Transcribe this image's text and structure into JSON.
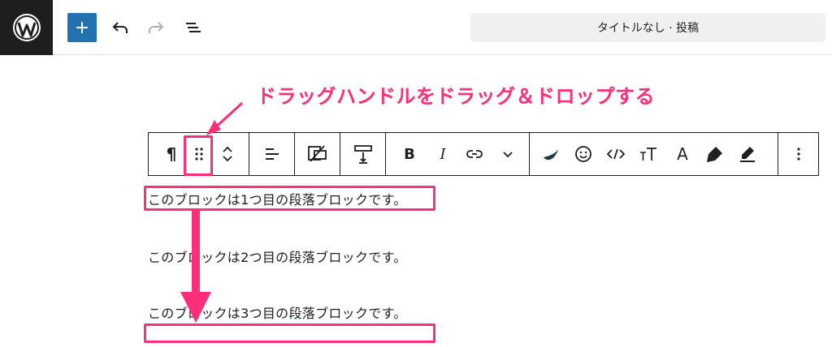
{
  "header": {
    "logo_icon": "wordpress-logo",
    "add_block_icon": "plus-icon",
    "undo_icon": "undo-icon",
    "redo_icon": "redo-icon",
    "list_view_icon": "list-view-icon",
    "document_title": "タイトルなし · 投稿"
  },
  "annotation": {
    "text": "ドラッグハンドルをドラッグ＆ドロップする",
    "color": "#ff2d7a"
  },
  "toolbar": {
    "paragraph_symbol": "¶",
    "tools": [
      "paragraph-icon",
      "drag-handle-icon",
      "move-up-icon",
      "move-down-icon",
      "align-left-icon",
      "image-swap-icon",
      "spacer-icon",
      "bold-icon",
      "italic-icon",
      "link-icon",
      "chevron-down-icon",
      "brand-leaf-icon",
      "emoji-icon",
      "code-icon",
      "text-size-icon",
      "font-icon",
      "highlighter-icon",
      "text-color-icon",
      "more-options-icon"
    ],
    "bold_label": "B",
    "italic_label": "I",
    "font_label": "A"
  },
  "blocks": [
    {
      "text": "このブロックは1つ目の段落ブロックです。"
    },
    {
      "text": "このブロックは2つ目の段落ブロックです。"
    },
    {
      "text": "このブロックは3つ目の段落ブロックです。"
    }
  ],
  "colors": {
    "accent": "#2271b1",
    "annotation": "#ff2d7a",
    "dark": "#1e1e1e"
  }
}
